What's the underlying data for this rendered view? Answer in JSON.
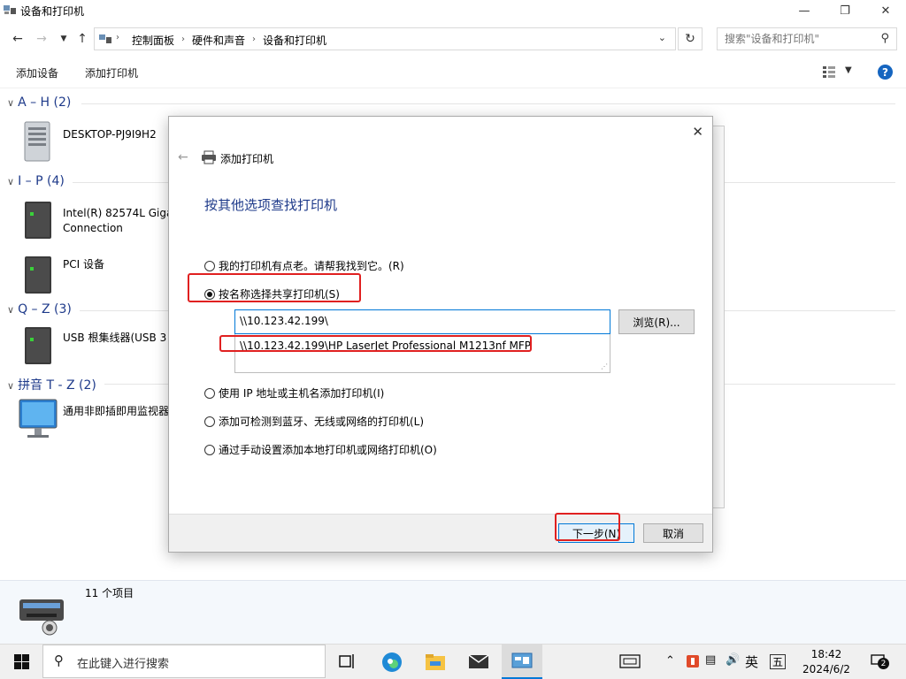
{
  "window": {
    "title": "设备和打印机"
  },
  "address": {
    "crumbs": [
      "控制面板",
      "硬件和声音",
      "设备和打印机"
    ],
    "search_placeholder": "搜索\"设备和打印机\""
  },
  "commands": {
    "add_device": "添加设备",
    "add_printer": "添加打印机"
  },
  "groups": [
    {
      "header": "A – H (2)",
      "devices": [
        "DESKTOP-PJ9I9H2"
      ]
    },
    {
      "header": "I – P (4)",
      "devices": [
        "Intel(R) 82574L Giga\nConnection",
        "PCI 设备"
      ]
    },
    {
      "header": "Q – Z (3)",
      "devices": [
        "USB 根集线器(USB 3"
      ]
    },
    {
      "header": "拼音 T - Z (2)",
      "devices": [
        "通用非即插即用监视器"
      ]
    }
  ],
  "status": {
    "items_count": "11 个项目"
  },
  "dialog": {
    "title": "添加打印机",
    "heading": "按其他选项查找打印机",
    "options": [
      {
        "label": "我的打印机有点老。请帮我找到它。(R)",
        "checked": false
      },
      {
        "label": "按名称选择共享打印机(S)",
        "checked": true
      },
      {
        "label": "使用 IP 地址或主机名添加打印机(I)",
        "checked": false
      },
      {
        "label": "添加可检测到蓝牙、无线或网络的打印机(L)",
        "checked": false
      },
      {
        "label": "通过手动设置添加本地打印机或网络打印机(O)",
        "checked": false
      }
    ],
    "path_value": "\\\\10.123.42.199\\",
    "suggestion": "\\\\10.123.42.199\\HP LaserJet Professional M1213nf MFP",
    "browse_label": "浏览(R)...",
    "next_label": "下一步(N)",
    "cancel_label": "取消"
  },
  "taskbar": {
    "search_placeholder": "在此键入进行搜索",
    "ime_lang": "英",
    "ime_mode": "五",
    "time": "18:42",
    "date": "2024/6/2",
    "notification_count": "2"
  },
  "colors": {
    "accent": "#0078d7",
    "heading": "#1e3a8a",
    "highlight": "#e02020"
  }
}
